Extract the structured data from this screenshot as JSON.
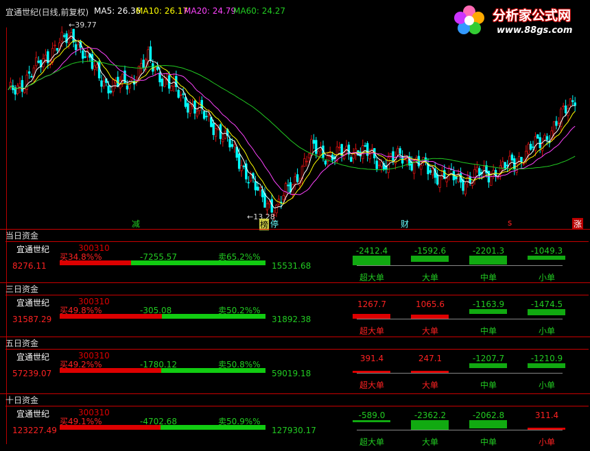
{
  "header": {
    "stock_title": "宜通世纪(日线,前复权)",
    "ma5": "MA5: 26.36",
    "ma10": "MA10: 26.17",
    "ma20": "MA20: 24.79",
    "ma60": "MA60: 24.27"
  },
  "logo": {
    "name": "分析家公式网",
    "url": "www.88gs.com"
  },
  "chart": {
    "high_label": "←39.77",
    "low_label": "←13.28",
    "signals": [
      "减",
      "榜",
      "停",
      "财",
      "s",
      "涨"
    ]
  },
  "panels": [
    {
      "title": "当日资金",
      "name": "宜通世纪",
      "code": "300310",
      "buy": "买34.8%%",
      "sell": "卖65.2%%",
      "net": "-7255.57",
      "left_value": "8276.11",
      "right_value": "15531.68",
      "buy_fraction": 0.348,
      "flows": [
        {
          "value": "-2412.4",
          "label": "超大单",
          "sign": "neg"
        },
        {
          "value": "-1592.6",
          "label": "大单",
          "sign": "neg"
        },
        {
          "value": "-2201.3",
          "label": "中单",
          "sign": "neg"
        },
        {
          "value": "-1049.3",
          "label": "小单",
          "sign": "neg"
        }
      ]
    },
    {
      "title": "三日资金",
      "name": "宜通世纪",
      "code": "300310",
      "buy": "买49.8%%",
      "sell": "卖50.2%%",
      "net": "-305.08",
      "left_value": "31587.29",
      "right_value": "31892.38",
      "buy_fraction": 0.498,
      "flows": [
        {
          "value": "1267.7",
          "label": "超大单",
          "sign": "pos"
        },
        {
          "value": "1065.6",
          "label": "大单",
          "sign": "pos"
        },
        {
          "value": "-1163.9",
          "label": "中单",
          "sign": "neg"
        },
        {
          "value": "-1474.5",
          "label": "小单",
          "sign": "neg"
        }
      ]
    },
    {
      "title": "五日资金",
      "name": "宜通世纪",
      "code": "300310",
      "buy": "买49.2%%",
      "sell": "卖50.8%%",
      "net": "-1780.12",
      "left_value": "57239.07",
      "right_value": "59019.18",
      "buy_fraction": 0.492,
      "flows": [
        {
          "value": "391.4",
          "label": "超大单",
          "sign": "pos"
        },
        {
          "value": "247.1",
          "label": "大单",
          "sign": "pos"
        },
        {
          "value": "-1207.7",
          "label": "中单",
          "sign": "neg"
        },
        {
          "value": "-1210.9",
          "label": "小单",
          "sign": "neg"
        }
      ]
    },
    {
      "title": "十日资金",
      "name": "宜通世纪",
      "code": "300310",
      "buy": "买49.1%%",
      "sell": "卖50.9%%",
      "net": "-4702.68",
      "left_value": "123227.49",
      "right_value": "127930.17",
      "buy_fraction": 0.491,
      "flows": [
        {
          "value": "-589.0",
          "label": "超大单",
          "sign": "neg"
        },
        {
          "value": "-2362.2",
          "label": "大单",
          "sign": "neg"
        },
        {
          "value": "-2062.8",
          "label": "中单",
          "sign": "neg"
        },
        {
          "value": "311.4",
          "label": "小单",
          "sign": "pos"
        }
      ]
    }
  ],
  "colors": {
    "up": "#dd1111",
    "down": "#00ffff",
    "ma5": "#ffffff",
    "ma10": "#ffff00",
    "ma20": "#ff44ff",
    "ma60": "#22cc22"
  }
}
